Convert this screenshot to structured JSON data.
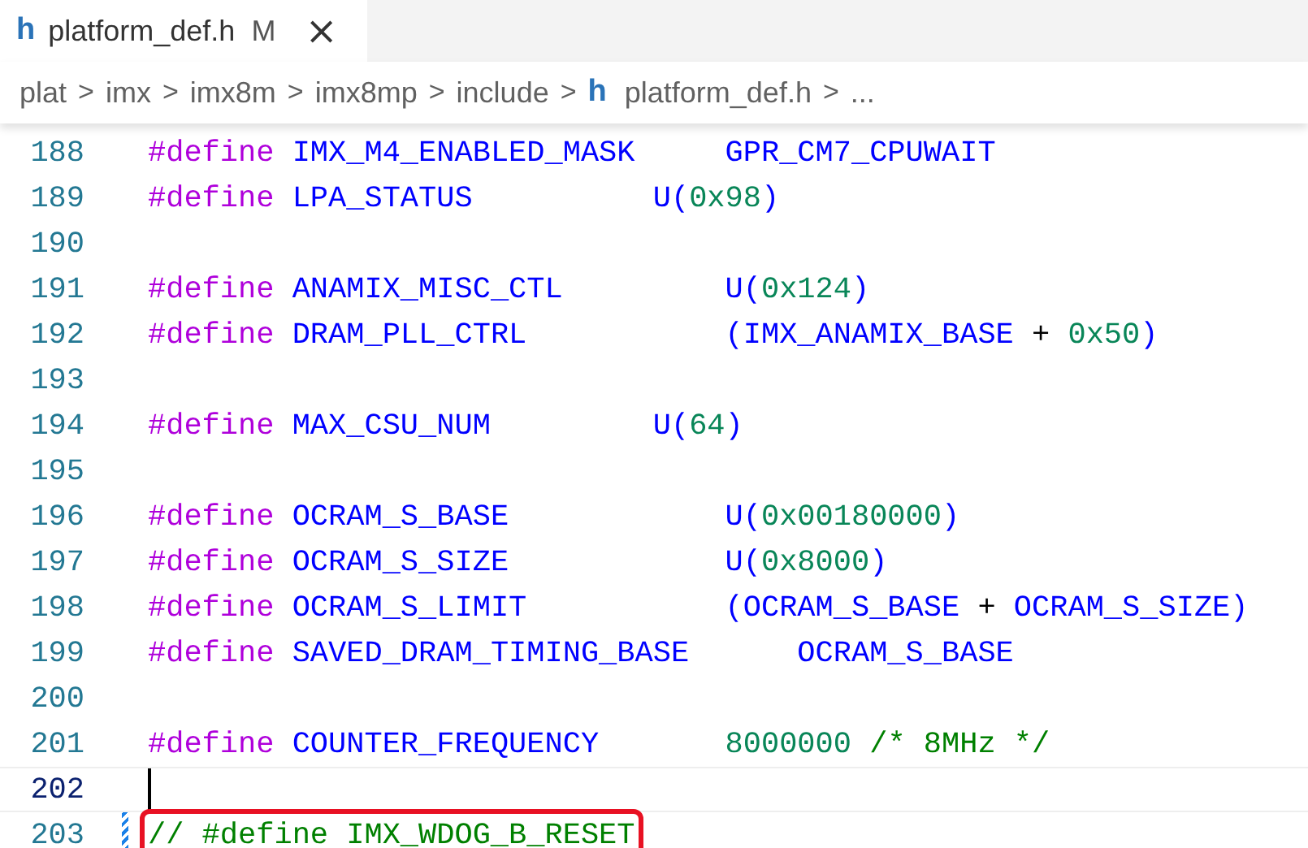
{
  "tabs": [
    {
      "icon_glyph": "h",
      "label": "platform_def.h",
      "status": "M",
      "close": "×",
      "selected": true
    }
  ],
  "breadcrumb": {
    "items": [
      {
        "text": "plat"
      },
      {
        "text": "imx"
      },
      {
        "text": "imx8m"
      },
      {
        "text": "imx8mp"
      },
      {
        "text": "include"
      },
      {
        "text": "platform_def.h",
        "icon_glyph": "h"
      },
      {
        "text": "..."
      }
    ],
    "separator": ">"
  },
  "lines": [
    {
      "number": "188",
      "active": false,
      "modified": false,
      "highlighted": false,
      "tokens": [
        {
          "kind": "directive",
          "text": "#define"
        },
        {
          "kind": "macro",
          "text": " IMX_M4_ENABLED_MASK     GPR_CM7_CPUWAIT"
        }
      ]
    },
    {
      "number": "189",
      "active": false,
      "modified": false,
      "highlighted": false,
      "tokens": [
        {
          "kind": "directive",
          "text": "#define"
        },
        {
          "kind": "macro",
          "text": " LPA_STATUS          U("
        },
        {
          "kind": "number",
          "text": "0x98"
        },
        {
          "kind": "macro",
          "text": ")"
        }
      ]
    },
    {
      "number": "190",
      "active": false,
      "modified": false,
      "highlighted": false
    },
    {
      "number": "191",
      "active": false,
      "modified": false,
      "highlighted": false,
      "tokens": [
        {
          "kind": "directive",
          "text": "#define"
        },
        {
          "kind": "macro",
          "text": " ANAMIX_MISC_CTL         U("
        },
        {
          "kind": "number",
          "text": "0x124"
        },
        {
          "kind": "macro",
          "text": ")"
        }
      ]
    },
    {
      "number": "192",
      "active": false,
      "modified": false,
      "highlighted": false,
      "tokens": [
        {
          "kind": "directive",
          "text": "#define"
        },
        {
          "kind": "macro",
          "text": " DRAM_PLL_CTRL           (IMX_ANAMIX_BASE "
        },
        {
          "kind": "plain",
          "text": "+ "
        },
        {
          "kind": "number",
          "text": "0x50"
        },
        {
          "kind": "macro",
          "text": ")"
        }
      ]
    },
    {
      "number": "193",
      "active": false,
      "modified": false,
      "highlighted": false
    },
    {
      "number": "194",
      "active": false,
      "modified": false,
      "highlighted": false,
      "tokens": [
        {
          "kind": "directive",
          "text": "#define"
        },
        {
          "kind": "macro",
          "text": " MAX_CSU_NUM         U("
        },
        {
          "kind": "number",
          "text": "64"
        },
        {
          "kind": "macro",
          "text": ")"
        }
      ]
    },
    {
      "number": "195",
      "active": false,
      "modified": false,
      "highlighted": false
    },
    {
      "number": "196",
      "active": false,
      "modified": false,
      "highlighted": false,
      "tokens": [
        {
          "kind": "directive",
          "text": "#define"
        },
        {
          "kind": "macro",
          "text": " OCRAM_S_BASE            U("
        },
        {
          "kind": "number",
          "text": "0x00180000"
        },
        {
          "kind": "macro",
          "text": ")"
        }
      ]
    },
    {
      "number": "197",
      "active": false,
      "modified": false,
      "highlighted": false,
      "tokens": [
        {
          "kind": "directive",
          "text": "#define"
        },
        {
          "kind": "macro",
          "text": " OCRAM_S_SIZE            U("
        },
        {
          "kind": "number",
          "text": "0x8000"
        },
        {
          "kind": "macro",
          "text": ")"
        }
      ]
    },
    {
      "number": "198",
      "active": false,
      "modified": false,
      "highlighted": false,
      "tokens": [
        {
          "kind": "directive",
          "text": "#define"
        },
        {
          "kind": "macro",
          "text": " OCRAM_S_LIMIT           (OCRAM_S_BASE "
        },
        {
          "kind": "plain",
          "text": "+ "
        },
        {
          "kind": "macro",
          "text": "OCRAM_S_SIZE)"
        }
      ]
    },
    {
      "number": "199",
      "active": false,
      "modified": false,
      "highlighted": false,
      "tokens": [
        {
          "kind": "directive",
          "text": "#define"
        },
        {
          "kind": "macro",
          "text": " SAVED_DRAM_TIMING_BASE      OCRAM_S_BASE"
        }
      ]
    },
    {
      "number": "200",
      "active": false,
      "modified": false,
      "highlighted": false
    },
    {
      "number": "201",
      "active": false,
      "modified": false,
      "highlighted": false,
      "tokens": [
        {
          "kind": "directive",
          "text": "#define"
        },
        {
          "kind": "macro",
          "text": " COUNTER_FREQUENCY       "
        },
        {
          "kind": "number",
          "text": "8000000 "
        },
        {
          "kind": "comment",
          "text": "/* 8MHz */"
        }
      ]
    },
    {
      "number": "202",
      "active": true,
      "modified": false,
      "highlighted": false
    },
    {
      "number": "203",
      "active": false,
      "modified": true,
      "highlighted": true,
      "tokens": [
        {
          "kind": "comment",
          "text": "// #define IMX_WDOG_B_RESET"
        }
      ]
    }
  ]
}
